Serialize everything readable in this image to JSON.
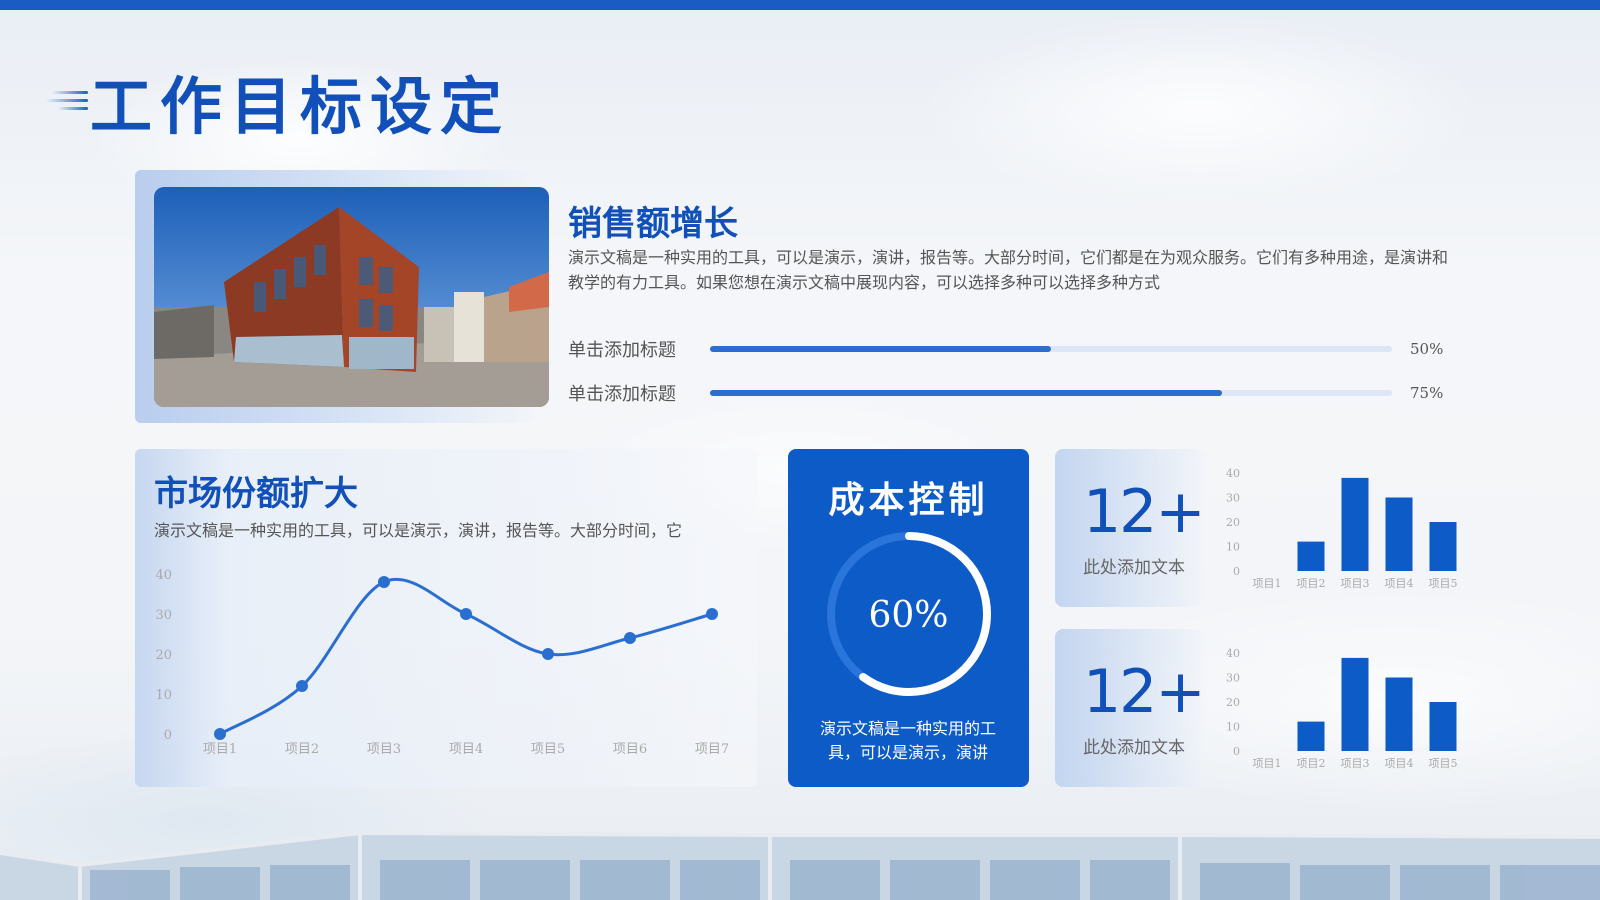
{
  "page": {
    "title": "工作目标设定",
    "accent": "#1a5cc4"
  },
  "sales": {
    "title": "销售额增长",
    "description": "演示文稿是一种实用的工具，可以是演示，演讲，报告等。大部分时间，它们都是在为观众服务。它们有多种用途，是演讲和教学的有力工具。如果您想在演示文稿中展现内容，可以选择多种可以选择多种方式",
    "progress": [
      {
        "label": "单击添加标题",
        "value": 50,
        "value_text": "50%"
      },
      {
        "label": "单击添加标题",
        "value": 75,
        "value_text": "75%"
      }
    ]
  },
  "market": {
    "title": "市场份额扩大",
    "description": "演示文稿是一种实用的工具，可以是演示，演讲，报告等。大部分时间，它"
  },
  "cost": {
    "title": "成本控制",
    "percent": 60,
    "percent_text": "60%",
    "description": "演示文稿是一种实用的工具，可以是演示，演讲"
  },
  "stats": [
    {
      "number": "12+",
      "label": "此处添加文本"
    },
    {
      "number": "12+",
      "label": "此处添加文本"
    }
  ],
  "chart_data": [
    {
      "type": "line",
      "categories": [
        "项目1",
        "项目2",
        "项目3",
        "项目4",
        "项目5",
        "项目6",
        "项目7"
      ],
      "values": [
        0,
        12,
        38,
        30,
        20,
        24,
        30
      ],
      "y_ticks": [
        "0",
        "10",
        "20",
        "30",
        "40"
      ],
      "ylim": [
        0,
        40
      ],
      "color": "#2a6fd0",
      "grid": false
    },
    {
      "type": "bar",
      "categories": [
        "项目1",
        "项目2",
        "项目3",
        "项目4",
        "项目5"
      ],
      "values": [
        0,
        12,
        38,
        30,
        20
      ],
      "y_ticks": [
        "0",
        "10",
        "20",
        "30",
        "40"
      ],
      "ylim": [
        0,
        40
      ],
      "color": "#0d5bc6",
      "grid": false
    },
    {
      "type": "bar",
      "categories": [
        "项目1",
        "项目2",
        "项目3",
        "项目4",
        "项目5"
      ],
      "values": [
        0,
        12,
        38,
        30,
        20
      ],
      "y_ticks": [
        "0",
        "10",
        "20",
        "30",
        "40"
      ],
      "ylim": [
        0,
        40
      ],
      "color": "#0d5bc6",
      "grid": false
    }
  ]
}
